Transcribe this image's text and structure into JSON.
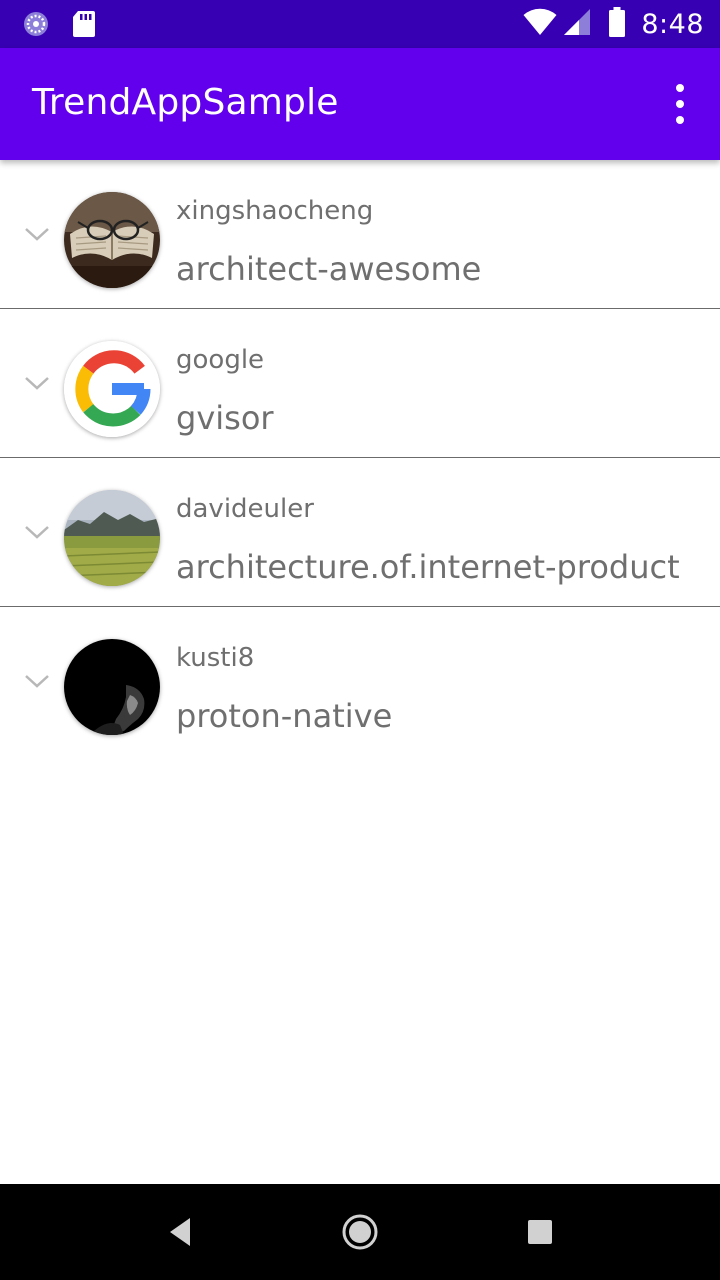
{
  "status_bar": {
    "time": "8:48",
    "icons": [
      "sync-icon",
      "sd-card-icon",
      "wifi-icon",
      "signal-icon",
      "battery-icon"
    ]
  },
  "app_bar": {
    "title": "TrendAppSample",
    "menu_icon": "more-vert-icon"
  },
  "repos": [
    {
      "owner": "xingshaocheng",
      "name": "architect-awesome",
      "avatar": "books-glasses-photo"
    },
    {
      "owner": "google",
      "name": "gvisor",
      "avatar": "google-logo"
    },
    {
      "owner": "davideuler",
      "name": "architecture.of.internet-product",
      "avatar": "landscape-photo"
    },
    {
      "owner": "kusti8",
      "name": "proton-native",
      "avatar": "dark-portrait-photo"
    }
  ],
  "nav_bar": {
    "buttons": [
      "back-icon",
      "home-icon",
      "recents-icon"
    ]
  },
  "colors": {
    "status_bar": "#3700b3",
    "app_bar": "#6200ee",
    "text_secondary": "#6f6f6f",
    "divider": "#6b6b6b"
  }
}
